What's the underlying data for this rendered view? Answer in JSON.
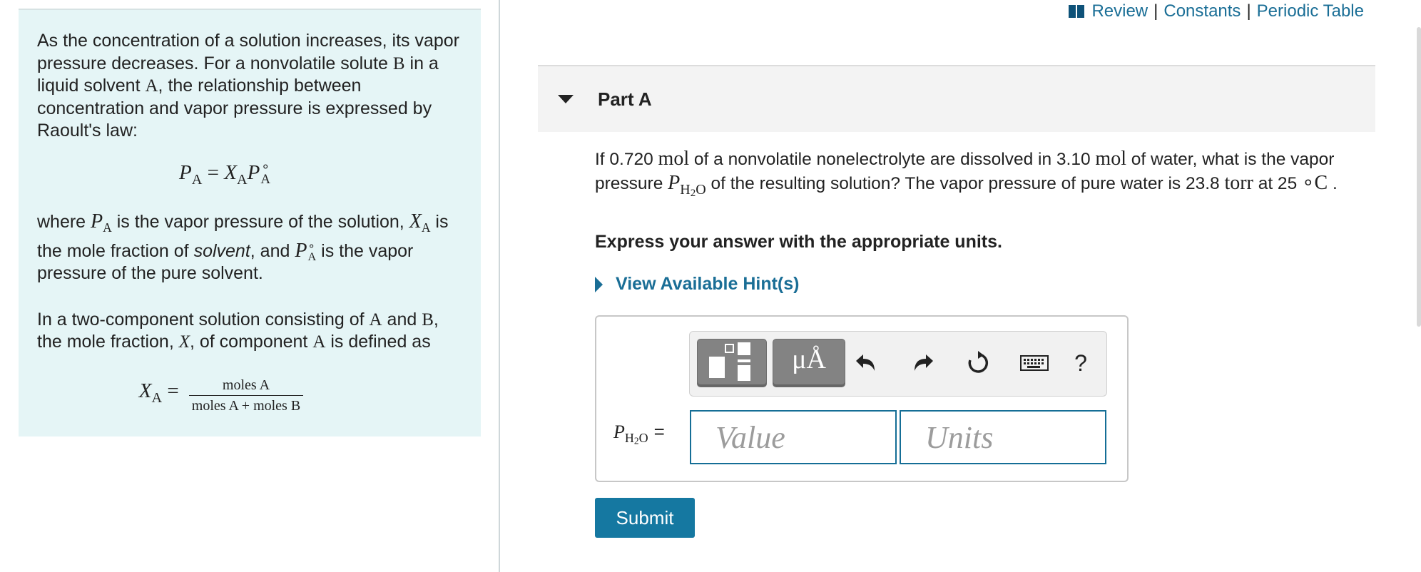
{
  "info": {
    "p1": {
      "t1": "As the concentration of a solution increases, its vapor pressure decreases. For a nonvolatile solute ",
      "B": "B",
      "t2": " in a liquid solvent ",
      "A": "A",
      "t3": ", the relationship between concentration and vapor pressure is expressed by Raoult's law:"
    },
    "raoult": {
      "P": "P",
      "A": "A",
      "eq": " = ",
      "X": "X",
      "deg": "∘"
    },
    "p2": {
      "t1": "where ",
      "t2": " is the vapor pressure of the solution, ",
      "t3": " is the mole fraction of ",
      "solvent": "solvent",
      "t4": ", and ",
      "t5": " is the vapor pressure of the pure solvent."
    },
    "p3": {
      "t1": "In a two-component solution consisting of ",
      "A": "A",
      "t2": " and ",
      "B": "B",
      "t3": ", the mole fraction, ",
      "X": "X",
      "t4": ", of component ",
      "t5": " is defined as"
    },
    "fraction": {
      "lhs_X": "X",
      "lhs_A": "A",
      "eq": "=",
      "numerator": "moles A",
      "denominator": "moles A + moles B"
    }
  },
  "links": {
    "review": "Review",
    "sep": "|",
    "constants": "Constants",
    "periodic": "Periodic Table"
  },
  "part": {
    "title": "Part A"
  },
  "question": {
    "t1": "If 0.720 ",
    "mol": "mol",
    "t2": " of a nonvolatile nonelectrolyte are dissolved in 3.10 ",
    "t3": " of water, what is the vapor pressure ",
    "P": "P",
    "H2O_H": "H",
    "H2O_2": "2",
    "H2O_O": "O",
    "t4": " of the resulting solution? The vapor pressure of pure water is 23.8 ",
    "torr": "torr",
    "t5": " at 25 ",
    "degC": "∘C",
    "t6": " ."
  },
  "express": "Express your answer with the appropriate units.",
  "hint": "View Available Hint(s)",
  "toolbar": {
    "units_button": "μÅ",
    "help": "?"
  },
  "answer": {
    "eq": "=",
    "value_placeholder": "Value",
    "units_placeholder": "Units"
  },
  "submit": "Submit"
}
